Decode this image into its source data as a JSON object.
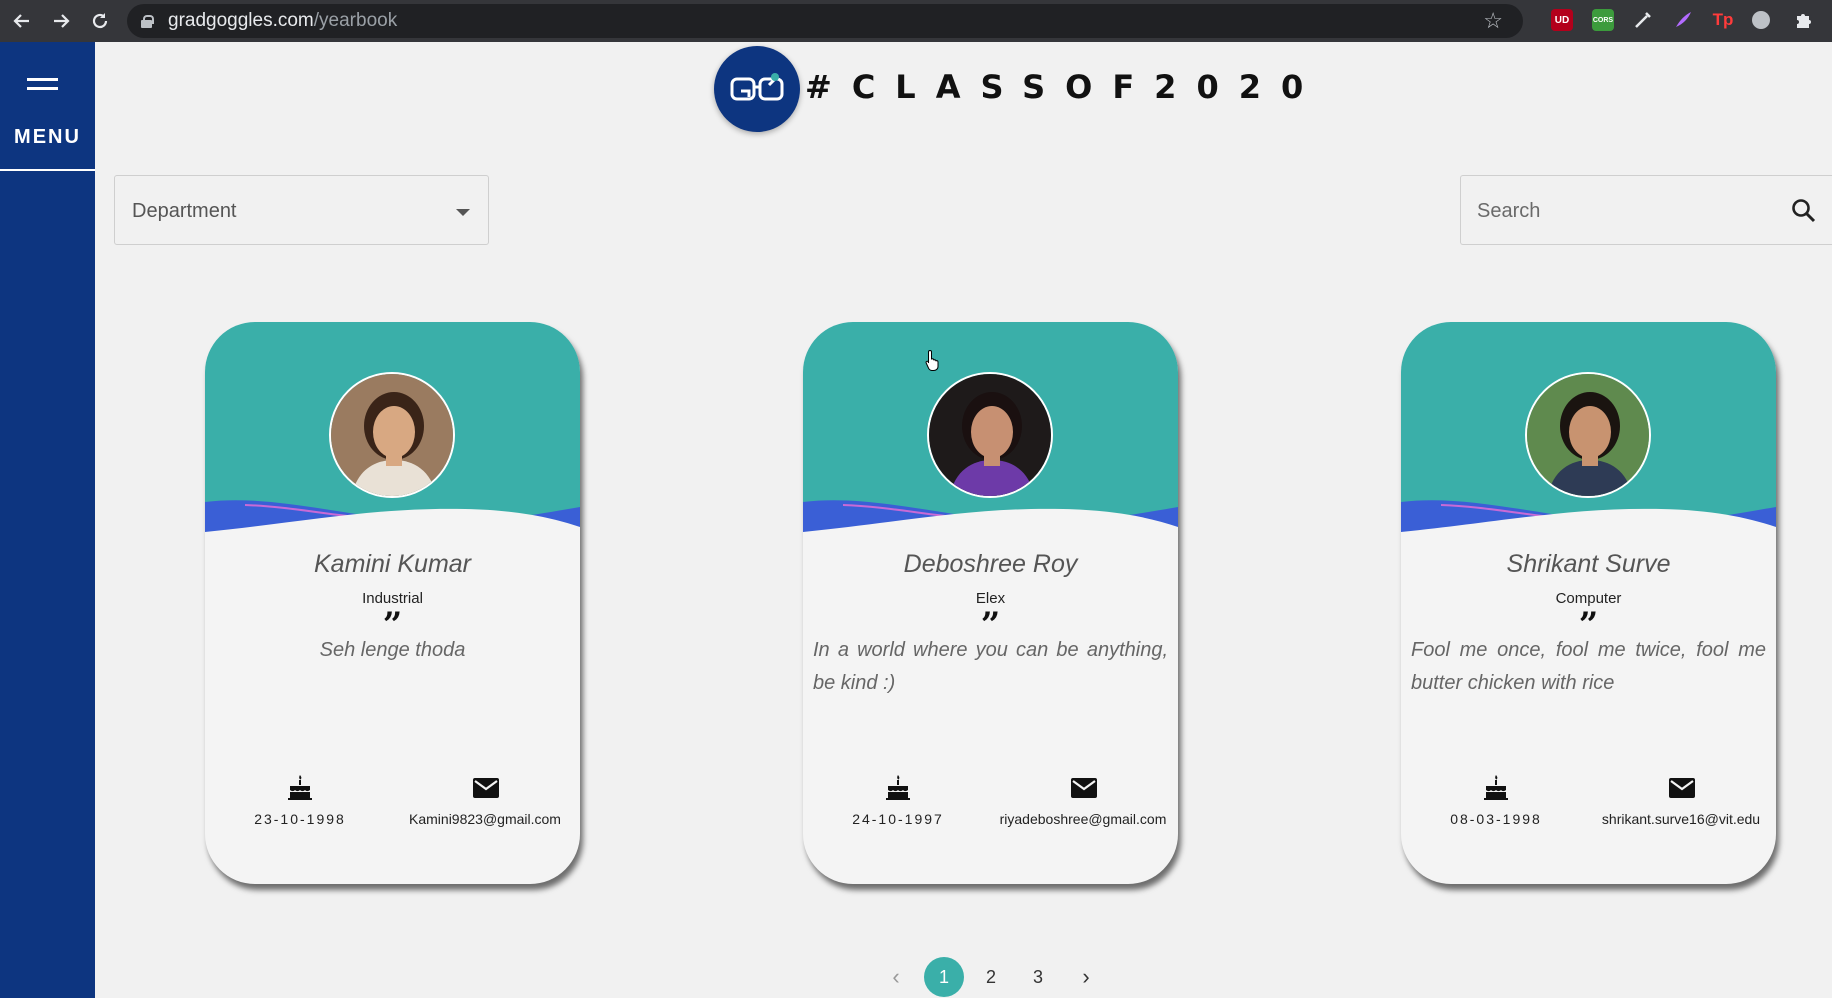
{
  "browser": {
    "url_host": "gradgoggles.com",
    "url_path": "/yearbook",
    "back_icon": "back-arrow-icon",
    "forward_icon": "forward-arrow-icon",
    "reload_icon": "reload-icon",
    "ext_label_1": "UD",
    "ext_label_2": "CORS",
    "ext_label_3": "Tp"
  },
  "sidebar": {
    "menu_label": "MENU"
  },
  "header": {
    "title": "#CLASSOF2020"
  },
  "filters": {
    "department_label": "Department",
    "search_placeholder": "Search"
  },
  "colors": {
    "teal": "#3aafa9",
    "navy": "#0d3580",
    "wave_blue": "#3a5fd6"
  },
  "cards": [
    {
      "name": "Kamini Kumar",
      "department": "Industrial",
      "quote_mark": "”",
      "quote": "Seh lenge thoda",
      "dob": "23-10-1998",
      "email": "Kamini9823@gmail.com"
    },
    {
      "name": "Deboshree Roy",
      "department": "Elex",
      "quote_mark": "”",
      "quote": "In a world where you can be anything, be kind :)",
      "dob": "24-10-1997",
      "email": "riyadeboshree@gmail.com"
    },
    {
      "name": "Shrikant Surve",
      "department": "Computer",
      "quote_mark": "”",
      "quote": "Fool me once, fool me twice, fool me butter chicken with rice",
      "dob": "08-03-1998",
      "email": "shrikant.surve16@vit.edu"
    }
  ],
  "pagination": {
    "prev": "‹",
    "pages": [
      "1",
      "2",
      "3"
    ],
    "current": "1",
    "next": "›"
  }
}
